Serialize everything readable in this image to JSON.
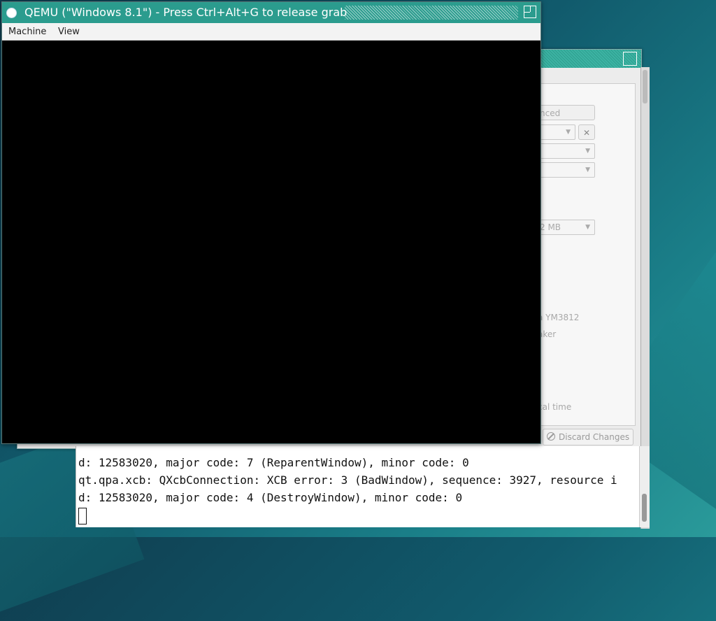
{
  "qemu": {
    "title": "QEMU (\"Windows 8.1\") - Press Ctrl+Alt+G to release grab",
    "menu": [
      "Machine",
      "View"
    ]
  },
  "settings": {
    "advanced_label": "nced",
    "memory_value": "2 MB",
    "audio_item_1": "a YM3812",
    "audio_item_2": "aker",
    "time_label": "cal time",
    "discard_label": "Discard Changes"
  },
  "terminal": {
    "lines": [
      "d: 12583020, major code: 7 (ReparentWindow), minor code: 0",
      "qt.qpa.xcb: QXcbConnection: XCB error: 3 (BadWindow), sequence: 3927, resource i",
      "d: 12583020, major code: 4 (DestroyWindow), minor code: 0"
    ]
  }
}
